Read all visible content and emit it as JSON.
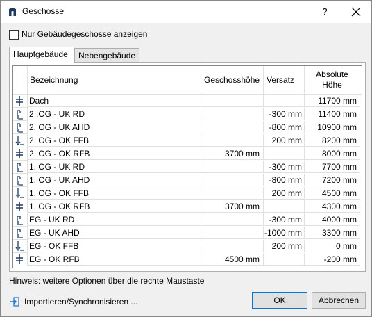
{
  "window": {
    "title": "Geschosse",
    "help": "?"
  },
  "checkbox": {
    "label": "Nur Gebäudegeschosse anzeigen",
    "checked": false
  },
  "tabs": [
    {
      "label": "Hauptgebäude",
      "active": true
    },
    {
      "label": "Nebengebäude",
      "active": false
    }
  ],
  "table": {
    "headers": {
      "name": "Bezeichnung",
      "height": "Geschosshöhe",
      "offset": "Versatz",
      "absolute": "Absolute Höhe"
    },
    "rows": [
      {
        "icon": "story-icon",
        "name": "Dach",
        "height": "",
        "offset": "",
        "absolute": "11700 mm"
      },
      {
        "icon": "offset-up-icon",
        "name": "2 .OG - UK RD",
        "height": "",
        "offset": "-300 mm",
        "absolute": "11400 mm"
      },
      {
        "icon": "offset-up-icon",
        "name": "2. OG - UK AHD",
        "height": "",
        "offset": "-800 mm",
        "absolute": "10900 mm"
      },
      {
        "icon": "offset-down-icon",
        "name": "2. OG - OK FFB",
        "height": "",
        "offset": "200 mm",
        "absolute": "8200 mm"
      },
      {
        "icon": "story-icon",
        "name": "2. OG - OK RFB",
        "height": "3700 mm",
        "offset": "",
        "absolute": "8000 mm"
      },
      {
        "icon": "offset-up-icon",
        "name": "1. OG - UK RD",
        "height": "",
        "offset": "-300 mm",
        "absolute": "7700 mm"
      },
      {
        "icon": "offset-up-icon",
        "name": "1. OG - UK AHD",
        "height": "",
        "offset": "-800 mm",
        "absolute": "7200 mm"
      },
      {
        "icon": "offset-down-icon",
        "name": "1. OG - OK FFB",
        "height": "",
        "offset": "200 mm",
        "absolute": "4500 mm"
      },
      {
        "icon": "story-icon",
        "name": "1. OG - OK RFB",
        "height": "3700 mm",
        "offset": "",
        "absolute": "4300 mm"
      },
      {
        "icon": "offset-up-icon",
        "name": "EG - UK RD",
        "height": "",
        "offset": "-300 mm",
        "absolute": "4000 mm"
      },
      {
        "icon": "offset-up-icon",
        "name": "EG - UK AHD",
        "height": "",
        "offset": "-1000 mm",
        "absolute": "3300 mm"
      },
      {
        "icon": "offset-down-icon",
        "name": "EG - OK FFB",
        "height": "",
        "offset": "200 mm",
        "absolute": "0 mm"
      },
      {
        "icon": "story-icon",
        "name": "EG - OK RFB",
        "height": "4500 mm",
        "offset": "",
        "absolute": "-200 mm"
      }
    ]
  },
  "hint": "Hinweis: weitere Optionen über die rechte Maustaste",
  "import": {
    "label": "Importieren/Synchronisieren ...",
    "icon": "import-icon"
  },
  "buttons": {
    "ok": "OK",
    "cancel": "Abbrechen"
  },
  "colors": {
    "accent": "#0078d7",
    "icon_dark": "#1e3a5f",
    "import_icon": "#1a73c8"
  }
}
